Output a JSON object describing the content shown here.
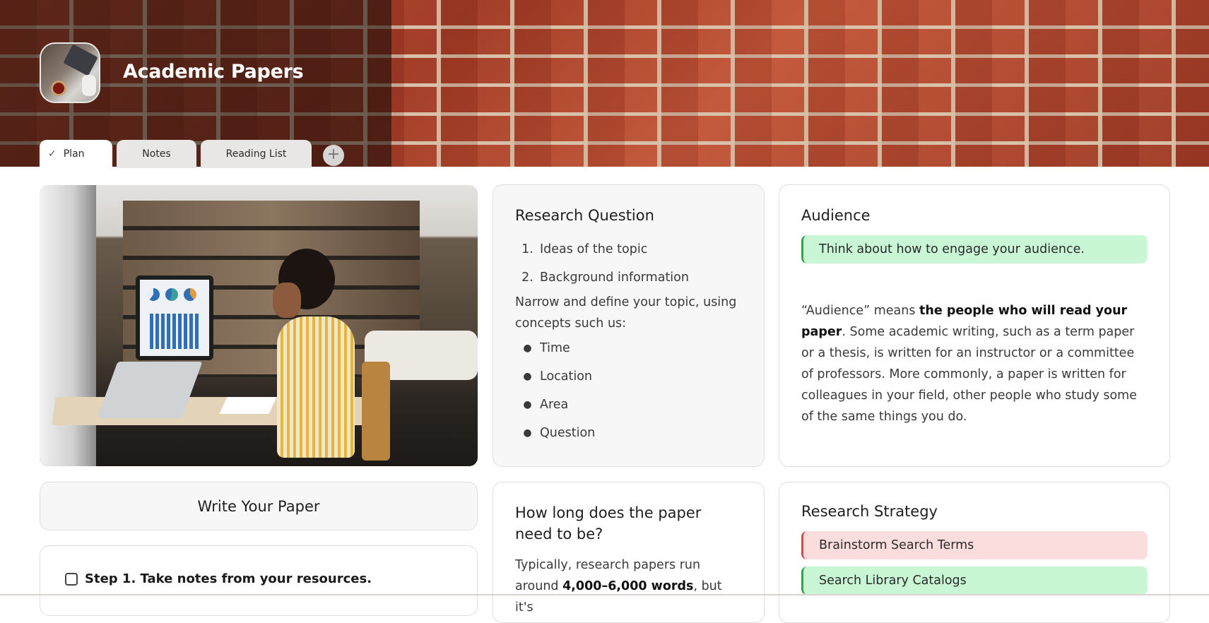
{
  "header": {
    "title": "Academic Papers",
    "app_icon": "laptop-desk-photo-icon"
  },
  "tabs": [
    {
      "label": "Plan",
      "active": true,
      "icon": "check-icon"
    },
    {
      "label": "Notes",
      "active": false
    },
    {
      "label": "Reading List",
      "active": false
    }
  ],
  "add_tab_label": "+",
  "research_question": {
    "title": "Research Question",
    "numbered": [
      {
        "num": "1.",
        "text": "Ideas of the topic"
      },
      {
        "num": "2.",
        "text": "Background information"
      }
    ],
    "paragraph": "Narrow and define your topic, using concepts such us:",
    "bullets": [
      "Time",
      "Location",
      "Area",
      "Question"
    ]
  },
  "audience": {
    "title": "Audience",
    "callout": "Think about how to engage your audience.",
    "body_start": "“Audience” means ",
    "body_bold": "the people who will read your paper",
    "body_end": ". Some academic writing, such as a term paper or a thesis, is written for an instructor or a committee of professors. More commonly, a paper is written for colleagues in your field, other people who study some of the same things you do."
  },
  "write_paper": {
    "title": "Write Your Paper",
    "step1": "Step 1. Take notes from your resources."
  },
  "how_long": {
    "title": "How long does the paper need to be?",
    "body_start": "Typically, research papers run around ",
    "body_bold": "4,000–6,000 words",
    "body_end": ", but it's"
  },
  "research_strategy": {
    "title": "Research Strategy",
    "items": [
      {
        "label": "Brainstorm Search Terms",
        "color": "#fbdddd",
        "accent": "#d24b4b"
      },
      {
        "label": "Search Library Catalogs",
        "color": "#c9f6d5",
        "accent": "#2fa44f"
      }
    ]
  },
  "colors": {
    "callout_green": "#c9f6d5",
    "callout_red": "#fbdddd",
    "brick": "#a5412b"
  }
}
